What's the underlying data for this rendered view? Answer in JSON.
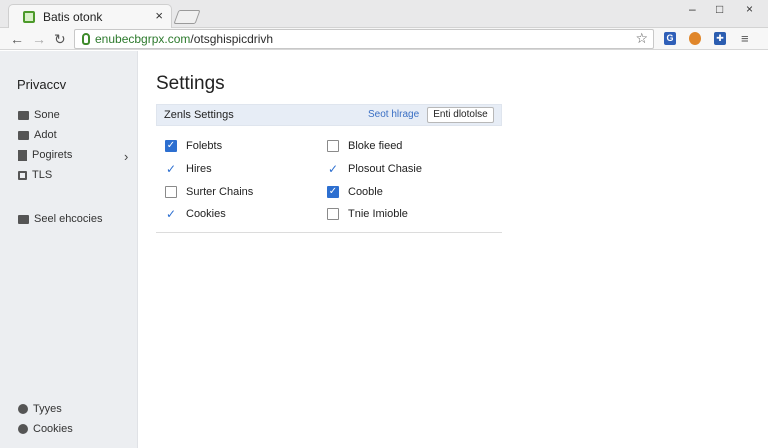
{
  "browser": {
    "tab_title": "Batis otonk",
    "tab_close": "×",
    "url_host": "enubecbgrpx.com",
    "url_path": "/otsghispicdrivh",
    "star": "☆",
    "window_controls": [
      "–",
      "□",
      "×"
    ],
    "extensions": [
      {
        "name": "extension-g-icon",
        "glyph": "G",
        "color": "#2f5fb8"
      },
      {
        "name": "extension-circle-icon",
        "glyph": "●",
        "color": "#e0862a"
      },
      {
        "name": "extension-puzzle-icon",
        "glyph": "✚",
        "color": "#2b5db0"
      }
    ],
    "menu_glyph": "≡"
  },
  "sidebar": {
    "heading": "Privaccv",
    "items": [
      {
        "label": "Sone",
        "icon": "monitor-icon"
      },
      {
        "label": "Adot",
        "icon": "image-icon"
      },
      {
        "label": "Pogirets",
        "icon": "tools-icon"
      },
      {
        "label": "TLS",
        "icon": "network-icon"
      },
      {
        "label": "Seel ehcocies",
        "icon": "folder-icon"
      }
    ],
    "bottom_items": [
      {
        "label": "Tyyes",
        "icon": "gear-icon"
      },
      {
        "label": "Cookies",
        "icon": "cookie-icon"
      }
    ]
  },
  "main": {
    "title": "Settings",
    "panel": {
      "title": "Zenls Settings",
      "link": "Seot hlrage",
      "button": "Enti dlotolse"
    },
    "options_left": [
      {
        "label": "Folebts",
        "state": "checked"
      },
      {
        "label": "Hires",
        "state": "tick"
      },
      {
        "label": "Surter Chains",
        "state": "unchecked"
      },
      {
        "label": "Cookies",
        "state": "tick"
      }
    ],
    "options_right": [
      {
        "label": "Bloke fieed",
        "state": "unchecked"
      },
      {
        "label": "Plosout Chasie",
        "state": "tick"
      },
      {
        "label": "Cooble",
        "state": "checked"
      },
      {
        "label": "Tnie Imioble",
        "state": "unchecked"
      }
    ]
  }
}
